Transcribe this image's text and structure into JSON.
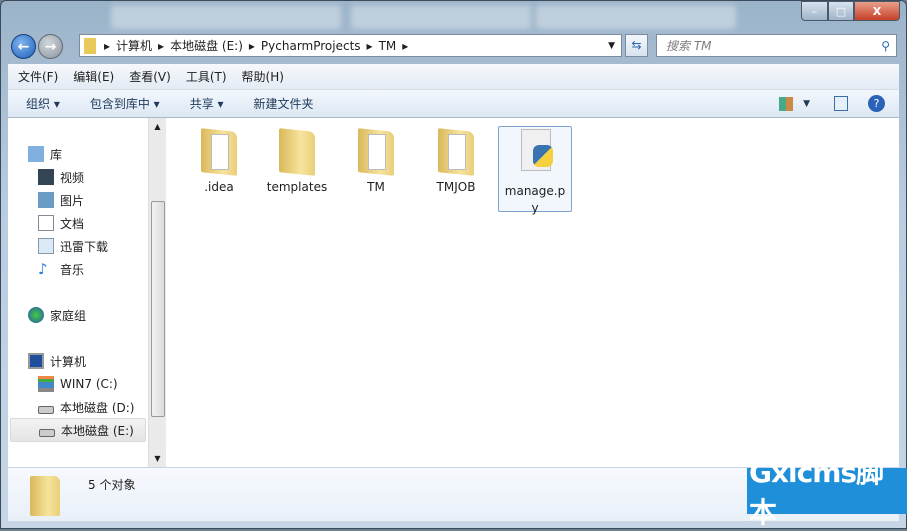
{
  "window": {
    "minimize": "–",
    "maximize": "□",
    "close": "X"
  },
  "address": {
    "segments": [
      "计算机",
      "本地磁盘 (E:)",
      "PycharmProjects",
      "TM"
    ],
    "separator": "▸"
  },
  "search": {
    "placeholder": "搜索 TM"
  },
  "menu": [
    "文件(F)",
    "编辑(E)",
    "查看(V)",
    "工具(T)",
    "帮助(H)"
  ],
  "toolbar": {
    "organize": "组织 ▾",
    "include_library": "包含到库中 ▾",
    "share": "共享 ▾",
    "new_folder": "新建文件夹"
  },
  "nav": {
    "libraries": {
      "label": "库",
      "items": [
        "视频",
        "图片",
        "文档",
        "迅雷下载",
        "音乐"
      ]
    },
    "homegroup": "家庭组",
    "computer": {
      "label": "计算机",
      "items": [
        "WIN7 (C:)",
        "本地磁盘 (D:)",
        "本地磁盘 (E:)"
      ]
    },
    "selected": "本地磁盘 (E:)"
  },
  "files": [
    {
      "name": ".idea",
      "type": "folder"
    },
    {
      "name": "templates",
      "type": "folder"
    },
    {
      "name": "TM",
      "type": "folder"
    },
    {
      "name": "TMJOB",
      "type": "folder"
    },
    {
      "name": "manage.py",
      "type": "python-file",
      "selected": true
    }
  ],
  "status": {
    "count": "5 个对象"
  },
  "watermark": "Gxlcms脚本",
  "colors": {
    "accent": "#1e8fd8",
    "selection": "#7da2ce"
  }
}
